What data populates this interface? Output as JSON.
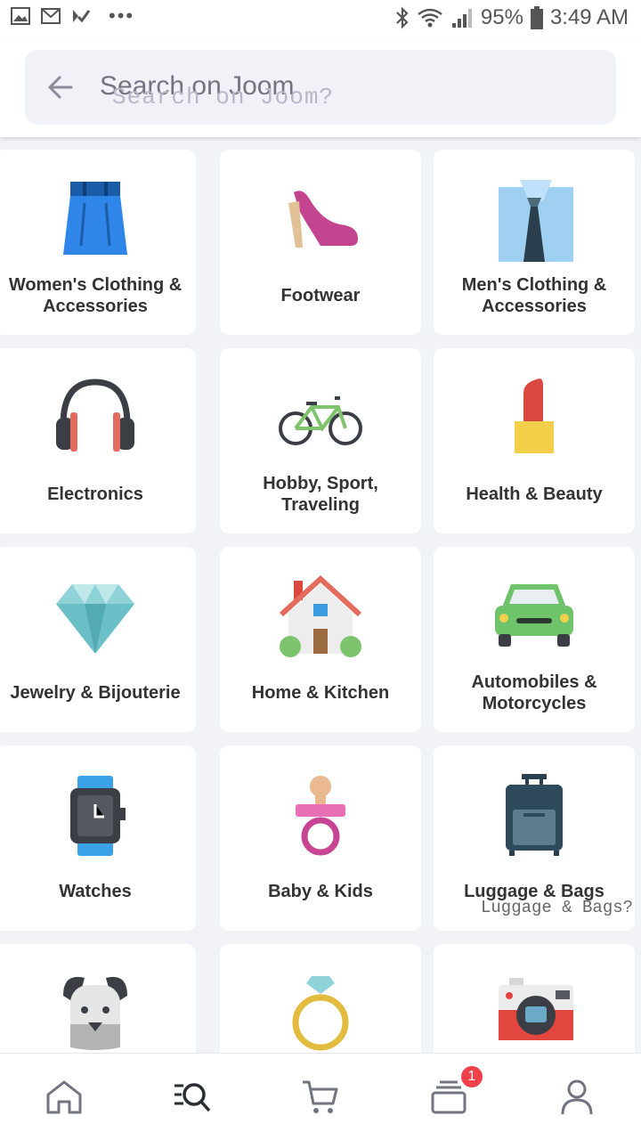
{
  "status_bar": {
    "left_icons": [
      "image-icon",
      "gmail-icon",
      "check-icon"
    ],
    "more": "•••",
    "battery": "95%",
    "time": "3:49 AM"
  },
  "search": {
    "text": "Search on Joom",
    "ghost_text": "Search on Joom?"
  },
  "categories": [
    {
      "label": "Women's Clothing & Accessories",
      "icon": "skirt-icon"
    },
    {
      "label": "Footwear",
      "icon": "high-heel-icon"
    },
    {
      "label": "Men's Clothing & Accessories",
      "icon": "shirt-tie-icon"
    },
    {
      "label": "Electronics",
      "icon": "headphones-icon"
    },
    {
      "label": "Hobby, Sport, Traveling",
      "icon": "bicycle-icon"
    },
    {
      "label": "Health & Beauty",
      "icon": "lipstick-icon"
    },
    {
      "label": "Jewelry & Bijouterie",
      "icon": "diamond-icon"
    },
    {
      "label": "Home & Kitchen",
      "icon": "house-icon"
    },
    {
      "label": "Automobiles & Motorcycles",
      "icon": "car-icon"
    },
    {
      "label": "Watches",
      "icon": "watch-icon"
    },
    {
      "label": "Baby & Kids",
      "icon": "pacifier-icon"
    },
    {
      "label": "Luggage & Bags",
      "icon": "suitcase-icon"
    },
    {
      "label": "",
      "icon": "dog-icon"
    },
    {
      "label": "",
      "icon": "ring-icon"
    },
    {
      "label": "",
      "icon": "camera-icon"
    }
  ],
  "ghost_label": "Luggage & Bags?",
  "bottom_nav": {
    "items": [
      "home-icon",
      "search-list-icon",
      "cart-icon",
      "orders-icon",
      "profile-icon"
    ],
    "orders_badge": "1"
  },
  "colors": {
    "badge": "#f0414b",
    "background": "#f2f3f7"
  }
}
